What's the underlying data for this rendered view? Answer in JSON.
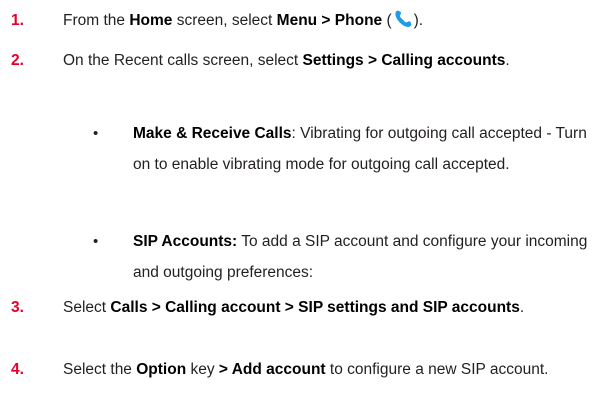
{
  "steps": [
    {
      "number": "1.",
      "p1": "From the ",
      "b1": "Home",
      "p2": " screen, select ",
      "b2": "Menu > Phone",
      "p3": " (",
      "icon": "phone-icon",
      "p4": ")."
    },
    {
      "number": "2.",
      "p1": "On the Recent calls screen, select ",
      "b1": "Settings > Calling accounts",
      "p2": "."
    },
    {
      "number": "3.",
      "p1": "Select ",
      "b1": "Calls > Calling account > SIP settings and SIP accounts",
      "p2": "."
    },
    {
      "number": "4.",
      "p1": "Select the ",
      "b1": "Option",
      "p2": " key ",
      "b2": "> Add account",
      "p3": " to configure a new SIP account."
    }
  ],
  "bullets": [
    {
      "symbol": "•",
      "term": "Make & Receive Calls",
      "sep": ": ",
      "desc": "Vibrating for outgoing call accepted - Turn on to enable vibrating mode for outgoing call accepted."
    },
    {
      "symbol": "•",
      "term": "SIP Accounts:",
      "sep": " ",
      "desc": "To add a SIP account and configure your incoming and outgoing preferences:"
    }
  ],
  "colors": {
    "step_number": "#e4002b",
    "phone_icon": "#1e9be9"
  }
}
